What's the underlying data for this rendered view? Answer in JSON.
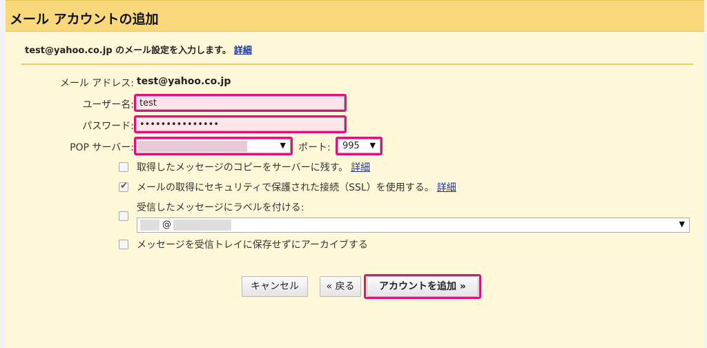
{
  "dialog": {
    "title": "メール アカウントの追加",
    "intro_text": "test@yahoo.co.jp のメール設定を入力します。",
    "intro_link": "詳細"
  },
  "form": {
    "email_label": "メール アドレス:",
    "email_value": "test@yahoo.co.jp",
    "username_label": "ユーザー名:",
    "username_value": "test",
    "password_label": "パスワード:",
    "password_value": "•••••••••••••••",
    "pop_label": "POP サーバー:",
    "pop_value": "",
    "port_label": "ポート:",
    "port_value": "995"
  },
  "options": {
    "leave_copy": {
      "label": "取得したメッセージのコピーをサーバーに残す。",
      "link": "詳細",
      "checked": false
    },
    "ssl": {
      "label": "メールの取得にセキュリティで保護された接続（SSL）を使用する。",
      "link": "詳細",
      "checked": true
    },
    "label_incoming": {
      "label": "受信したメッセージにラベルを付ける:",
      "checked": false,
      "select_value": "@"
    },
    "archive": {
      "label": "メッセージを受信トレイに保存せずにアーカイブする",
      "checked": false
    }
  },
  "buttons": {
    "cancel": "キャンセル",
    "back": "« 戻る",
    "add_account": "アカウントを追加 »"
  },
  "colors": {
    "title_bar": "#f8d87a",
    "body_bg": "#fff8d8",
    "highlight": "#e0117a",
    "link": "#1a33a8"
  }
}
